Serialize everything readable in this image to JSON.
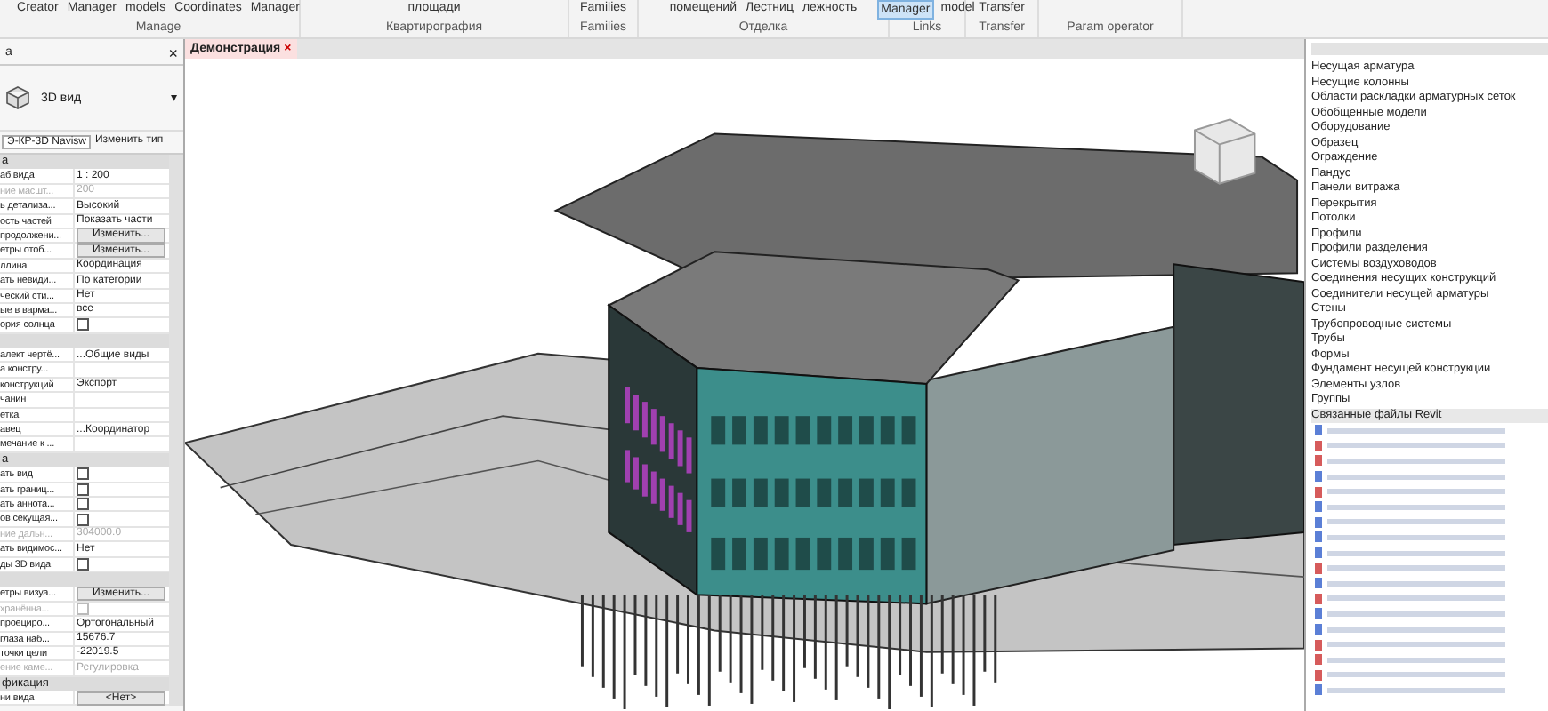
{
  "ribbon": {
    "groups": [
      {
        "panel": "Manage",
        "items": [
          {
            "label": "Creator",
            "selected": false
          },
          {
            "label": "Manager",
            "selected": false
          },
          {
            "label": "models",
            "selected": false
          },
          {
            "label": "Coordinates",
            "selected": false
          },
          {
            "label": "Manager",
            "selected": false
          }
        ]
      },
      {
        "panel": "Квартирография",
        "items": [
          {
            "label": "площади",
            "selected": false
          }
        ]
      },
      {
        "panel": "Families",
        "items": [
          {
            "label": "Families",
            "selected": false
          }
        ]
      },
      {
        "panel": "Отделка",
        "items": [
          {
            "label": "помещений",
            "selected": false
          },
          {
            "label": "Лестниц",
            "selected": false
          },
          {
            "label": "лежность",
            "selected": false
          }
        ]
      },
      {
        "panel": "Links",
        "items": [
          {
            "label": "Manager",
            "selected": true
          },
          {
            "label": "model",
            "selected": false
          }
        ]
      },
      {
        "panel": "Transfer",
        "items": [
          {
            "label": "Transfer",
            "selected": false
          }
        ]
      },
      {
        "panel": "Param operator"
      }
    ]
  },
  "properties": {
    "title": "а",
    "close": "×",
    "view_type": "3D вид",
    "view_type_caret": "▾",
    "type_selector": "Э-КР-3D Navisw",
    "edit_type": "Изменить тип",
    "rows": [
      {
        "kind": "header",
        "label": "а"
      },
      {
        "kind": "text",
        "label": "аб вида",
        "value": "1 : 200",
        "disabled": false
      },
      {
        "kind": "text",
        "label": "ние масшт...",
        "value": "200",
        "disabled": true
      },
      {
        "kind": "text",
        "label": "ь детализа...",
        "value": "Высокий",
        "disabled": false
      },
      {
        "kind": "text",
        "label": "ость частей",
        "value": "Показать части",
        "disabled": false
      },
      {
        "kind": "button",
        "label": "продолжени...",
        "value": "Изменить..."
      },
      {
        "kind": "button",
        "label": "етры отоб...",
        "value": "Изменить..."
      },
      {
        "kind": "text",
        "label": "ллина",
        "value": "Координация",
        "disabled": false
      },
      {
        "kind": "text",
        "label": "ать невиди...",
        "value": "По категории",
        "disabled": false
      },
      {
        "kind": "text",
        "label": "ческий сти...",
        "value": "Нет",
        "disabled": false
      },
      {
        "kind": "text",
        "label": "ые в варма...",
        "value": "все",
        "disabled": false
      },
      {
        "kind": "checkbox",
        "label": "ория солнца",
        "checked": false,
        "disabled": false
      },
      {
        "kind": "header",
        "label": ""
      },
      {
        "kind": "text",
        "label": "алект чертё...",
        "value": "...Общие виды",
        "disabled": false
      },
      {
        "kind": "text",
        "label": "а констру..."
      },
      {
        "kind": "text",
        "label": "конструкций",
        "value": "Экспорт",
        "disabled": false
      },
      {
        "kind": "text",
        "label": "чанин"
      },
      {
        "kind": "text",
        "label": "етка"
      },
      {
        "kind": "text",
        "label": "авец",
        "value": "...Координатор",
        "disabled": false
      },
      {
        "kind": "text",
        "label": "мечание к ..."
      },
      {
        "kind": "header",
        "label": "а"
      },
      {
        "kind": "checkbox",
        "label": "ать вид",
        "checked": false,
        "disabled": false
      },
      {
        "kind": "checkbox",
        "label": "ать границ...",
        "checked": false,
        "disabled": false
      },
      {
        "kind": "checkbox",
        "label": "ать аннота...",
        "checked": false,
        "disabled": false
      },
      {
        "kind": "checkbox",
        "label": "ов секущая...",
        "checked": false,
        "disabled": false
      },
      {
        "kind": "text",
        "label": "ние дальн...",
        "value": "304000.0",
        "disabled": true
      },
      {
        "kind": "text",
        "label": "ать видимос...",
        "value": "Нет",
        "disabled": false
      },
      {
        "kind": "checkbox",
        "label": "ды 3D вида",
        "checked": false,
        "disabled": false
      },
      {
        "kind": "header",
        "label": ""
      },
      {
        "kind": "button",
        "label": "етры визуа...",
        "value": "Изменить..."
      },
      {
        "kind": "checkbox",
        "label": "хранённа...",
        "checked": false,
        "disabled": true
      },
      {
        "kind": "text",
        "label": "проециро...",
        "value": "Ортогональный",
        "disabled": false
      },
      {
        "kind": "text",
        "label": "глаза наб...",
        "value": "15676.7",
        "disabled": false
      },
      {
        "kind": "text",
        "label": "точки цели",
        "value": "-22019.5",
        "disabled": false
      },
      {
        "kind": "text",
        "label": "ение каме...",
        "value": "Регулировка",
        "disabled": true
      },
      {
        "kind": "header",
        "label": "фикация"
      },
      {
        "kind": "button",
        "label": "ни вида",
        "value": "<Нет>"
      }
    ]
  },
  "view_tabs": [
    {
      "label": "Демонстрация",
      "close": "×",
      "selected": true
    }
  ],
  "project_browser": {
    "categories": [
      "Несущая арматура",
      "Несущие колонны",
      "Области раскладки арматурных сеток",
      "Обобщенные модели",
      "Оборудование",
      "Образец",
      "Ограждение",
      "Пандус",
      "Панели витража",
      "Перекрытия",
      "Потолки",
      "Профили",
      "Профили разделения",
      "Системы воздуховодов",
      "Соединения несущих конструкций",
      "Соединители несущей арматуры",
      "Стены",
      "Трубопроводные системы",
      "Трубы",
      "Формы",
      "Фундамент несущей конструкции",
      "Элементы узлов",
      "Группы"
    ],
    "linked_header": "Связанные файлы Revit",
    "linked_files": [
      {
        "color": "#5b7fd6"
      },
      {
        "color": "#d65b5b"
      },
      {
        "color": "#d65b5b"
      },
      {
        "color": "#5b7fd6"
      },
      {
        "color": "#d65b5b"
      },
      {
        "color": "#5b7fd6"
      },
      {
        "color": "#5b7fd6"
      },
      {
        "color": "#5b7fd6"
      },
      {
        "color": "#5b7fd6"
      },
      {
        "color": "#d65b5b"
      },
      {
        "color": "#5b7fd6"
      },
      {
        "color": "#d65b5b"
      },
      {
        "color": "#5b7fd6"
      },
      {
        "color": "#5b7fd6"
      },
      {
        "color": "#d65b5b"
      },
      {
        "color": "#d65b5b"
      },
      {
        "color": "#d65b5b"
      },
      {
        "color": "#5b7fd6"
      }
    ]
  }
}
